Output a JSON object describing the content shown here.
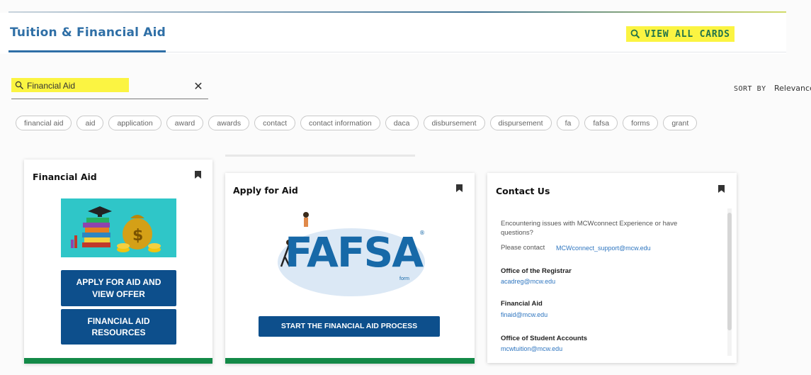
{
  "header": {
    "title": "Tuition & Financial Aid",
    "view_all_label": "VIEW ALL CARDS"
  },
  "search": {
    "value": "Financial Aid",
    "clear_symbol": "✕"
  },
  "sort": {
    "label": "SORT BY",
    "value": "Relevance"
  },
  "chips": [
    "financial aid",
    "aid",
    "application",
    "award",
    "awards",
    "contact",
    "contact information",
    "daca",
    "disbursement",
    "dispursement",
    "fa",
    "fafsa",
    "forms",
    "grant"
  ],
  "cards": {
    "financial_aid": {
      "title": "Financial Aid",
      "button_1": "APPLY FOR AID AND VIEW OFFER",
      "button_2": "FINANCIAL AID RESOURCES"
    },
    "apply_for_aid": {
      "title": "Apply for Aid",
      "logo_text": "FAFSA",
      "logo_sub": "form",
      "button": "START THE FINANCIAL AID PROCESS"
    },
    "contact_us": {
      "title": "Contact Us",
      "intro": "Encountering issues with MCWconnect Experience or have questions?",
      "please_contact": "Please contact",
      "support_email": "MCWconnect_support@mcw.edu",
      "registrar_heading": "Office of the Registrar",
      "registrar_email": "acadreg@mcw.edu",
      "finaid_heading": "Financial Aid",
      "finaid_email": "finaid@mcw.edu",
      "accounts_heading": "Office of Student Accounts",
      "accounts_email": "mcwtuition@mcw.edu"
    }
  },
  "colors": {
    "brand_blue": "#2f6fa6",
    "button_blue": "#0d4f8c",
    "highlight_yellow": "#fbf442",
    "accent_green": "#138a48"
  }
}
